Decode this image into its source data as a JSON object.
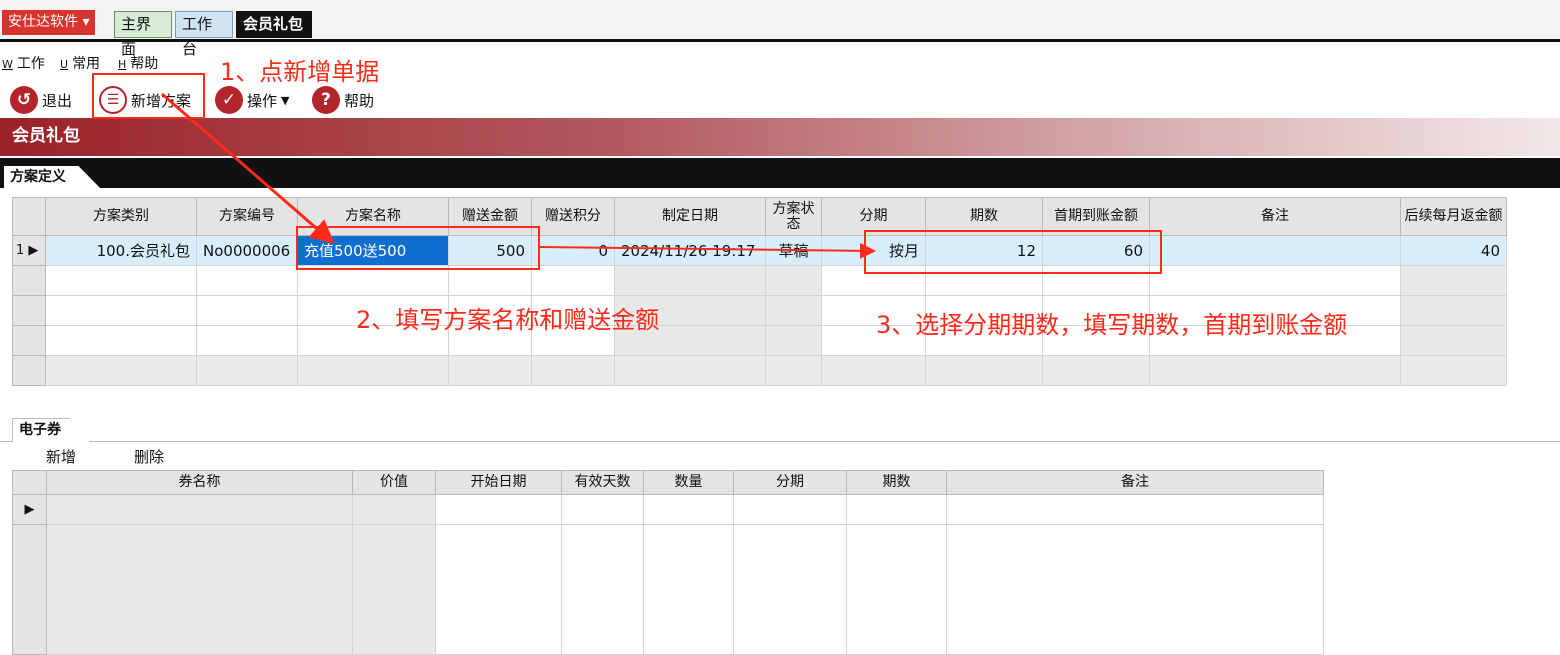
{
  "top_tabs": {
    "app_menu": "安仕达软件",
    "tabs": [
      "主界面",
      "工作台",
      "会员礼包"
    ]
  },
  "menubar": [
    {
      "hotkey": "W",
      "label": "工作"
    },
    {
      "hotkey": "U",
      "label": "常用"
    },
    {
      "hotkey": "H",
      "label": "帮助"
    }
  ],
  "toolbar": {
    "exit": "退出",
    "new_plan": "新增方案",
    "operate": "操作",
    "help": "帮助"
  },
  "page_title": "会员礼包",
  "plan_section": {
    "tab": "方案定义",
    "columns": [
      "方案类别",
      "方案编号",
      "方案名称",
      "赠送金额",
      "赠送积分",
      "制定日期",
      "方案状态",
      "分期",
      "期数",
      "首期到账金额",
      "备注",
      "后续每月返金额"
    ],
    "rows": [
      {
        "row_no": "1",
        "category": "100.会员礼包",
        "code": "No0000006",
        "name": "充值500送500",
        "amount": "500",
        "points": "0",
        "date": "2024/11/26 19:17",
        "status": "草稿",
        "installment": "按月",
        "periods": "12",
        "first_amount": "60",
        "remark": "",
        "monthly_return": "40"
      }
    ]
  },
  "coupon_section": {
    "tab": "电子券",
    "add": "新增",
    "delete": "删除",
    "columns": [
      "券名称",
      "价值",
      "开始日期",
      "有效天数",
      "数量",
      "分期",
      "期数",
      "备注"
    ]
  },
  "annotations": {
    "step1": "1、点新增单据",
    "step2": "2、填写方案名称和赠送金额",
    "step3": "3、选择分期期数，填写期数，首期到账金额",
    "color": "#ff2a1a"
  },
  "colors": {
    "brand_red": "#b1252b",
    "selection": "#d9eefc",
    "editing": "#0e6fd0"
  }
}
